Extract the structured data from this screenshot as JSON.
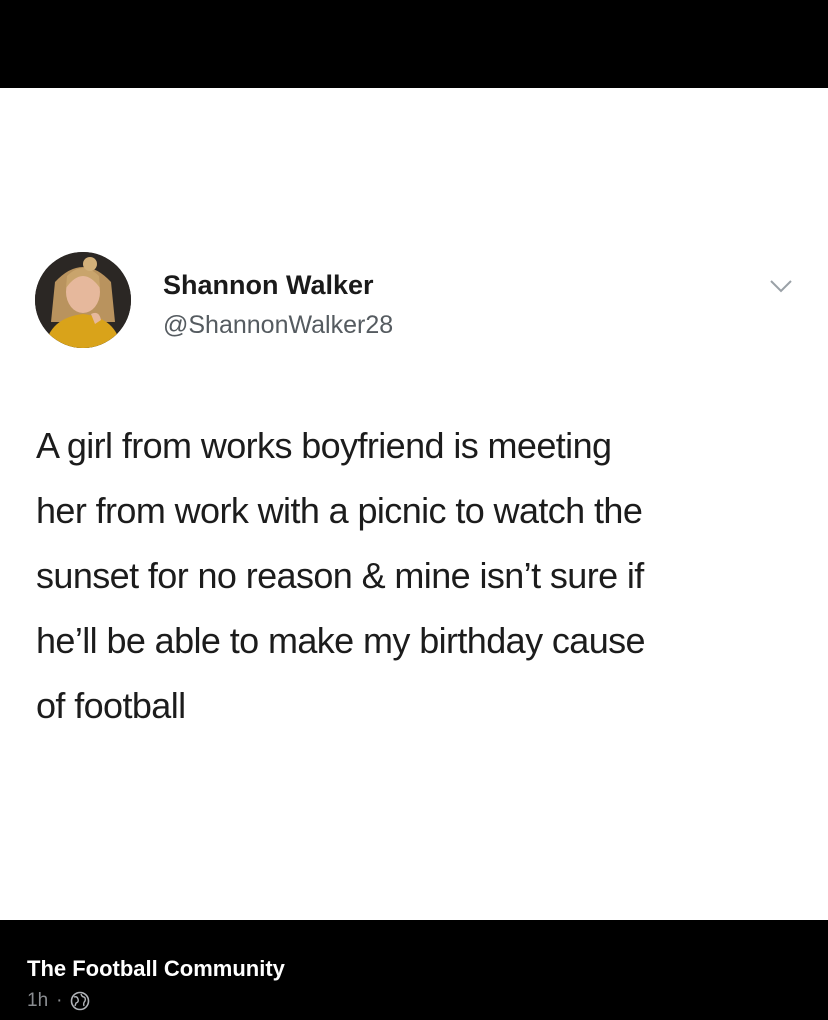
{
  "tweet": {
    "display_name": "Shannon Walker",
    "handle": "@ShannonWalker28",
    "text": "A girl from works boyfriend is meeting\nher from work with a picnic to watch the\nsunset for no reason & mine isn’t sure if\nhe’ll be able to make my birthday cause\nof football"
  },
  "post": {
    "page_name": "The Football Community",
    "timestamp": "1h",
    "separator": "·",
    "privacy_icon": "globe-icon"
  },
  "colors": {
    "background": "#000000",
    "tweet_background": "#ffffff",
    "text": "#1c1c1c",
    "handle": "#555b60",
    "meta": "#8a8d91"
  }
}
